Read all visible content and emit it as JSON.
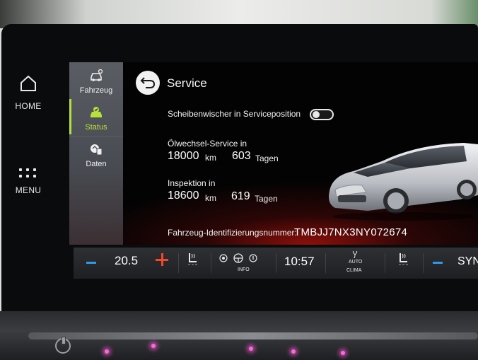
{
  "hard_keys": {
    "home_label": "HOME",
    "menu_label": "MENU"
  },
  "sidebar": {
    "items": [
      {
        "label": "Fahrzeug",
        "icon": "car-settings-icon",
        "active": false
      },
      {
        "label": "Status",
        "icon": "car-status-icon",
        "active": true
      },
      {
        "label": "Daten",
        "icon": "fuel-data-icon",
        "active": false
      }
    ]
  },
  "header": {
    "back_icon": "back-arrow-icon",
    "title": "Service"
  },
  "wiper": {
    "label": "Scheibenwischer in Serviceposition",
    "toggle_on": false
  },
  "oil_service": {
    "label": "Ölwechsel-Service in",
    "km_value": "18000",
    "km_unit": "km",
    "days_value": "603",
    "days_unit": "Tagen"
  },
  "inspection": {
    "label": "Inspektion in",
    "km_value": "18600",
    "km_unit": "km",
    "days_value": "619",
    "days_unit": "Tagen"
  },
  "vin": {
    "label": "Fahrzeug-Identifizierungsnummer:",
    "value": "TMBJJ7NX3NY072674"
  },
  "climate_bar": {
    "temperature": "20.5",
    "info_label": "INFO",
    "clock": "10:57",
    "auto_label": "AUTO",
    "clima_label": "CLIMA",
    "sync_label": "SYN"
  },
  "colors": {
    "accent_active": "#b8e23a",
    "minus_blue": "#2e9ae8",
    "plus_red": "#f04a2a",
    "ambient_red": "#96100a"
  }
}
